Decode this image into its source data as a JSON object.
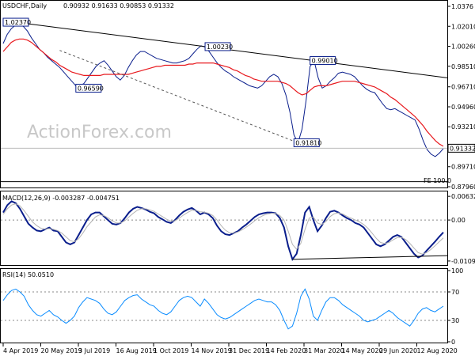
{
  "chart_data": [
    {
      "type": "line",
      "panel": "price",
      "header": "USDCHF,Daily",
      "header_values": "0.90932 0.91633 0.90853 0.91332",
      "watermark": "ActionForex.com",
      "fe_label": "FE 100.0",
      "last_price": "0.91332",
      "ylim": [
        0.8796,
        1.0376
      ],
      "y_ticks": [
        1.0376,
        1.0201,
        1.0026,
        0.9851,
        0.9671,
        0.9496,
        0.9321,
        0.9146,
        0.8971,
        0.8796
      ],
      "y_tick_labels": [
        "1.0376",
        "1.02010",
        "1.00260",
        "0.98510",
        "0.96710",
        "0.94960",
        "0.93210",
        "0.91460",
        "0.89710",
        "0.87960"
      ],
      "x_labels": [
        "4 Apr 2019",
        "20 May 2019",
        "3 Jul 2019",
        "16 Aug 2019",
        "1 Oct 2019",
        "14 Nov 2019",
        "31 Dec 2019",
        "14 Feb 2020",
        "31 Mar 2020",
        "14 May 2020",
        "29 Jun 2020",
        "12 Aug 2020"
      ],
      "series": [
        {
          "name": "price",
          "color": "#0a1e8c",
          "values": [
            1.005,
            1.013,
            1.018,
            1.021,
            1.022,
            1.02,
            1.016,
            1.01,
            1.005,
            1.0,
            0.997,
            0.993,
            0.99,
            0.987,
            0.984,
            0.98,
            0.976,
            0.972,
            0.968,
            0.968,
            0.97,
            0.975,
            0.98,
            0.985,
            0.988,
            0.99,
            0.986,
            0.981,
            0.976,
            0.973,
            0.977,
            0.984,
            0.99,
            0.995,
            0.998,
            0.998,
            0.996,
            0.994,
            0.992,
            0.991,
            0.99,
            0.989,
            0.988,
            0.988,
            0.989,
            0.99,
            0.992,
            0.996,
            1.0,
            1.003,
            1.002,
            0.998,
            0.993,
            0.988,
            0.984,
            0.981,
            0.979,
            0.976,
            0.974,
            0.972,
            0.97,
            0.968,
            0.967,
            0.966,
            0.968,
            0.972,
            0.976,
            0.978,
            0.976,
            0.97,
            0.96,
            0.945,
            0.925,
            0.918,
            0.93,
            0.955,
            0.985,
            0.99,
            0.975,
            0.966,
            0.968,
            0.972,
            0.975,
            0.979,
            0.98,
            0.979,
            0.978,
            0.976,
            0.972,
            0.968,
            0.965,
            0.963,
            0.962,
            0.957,
            0.952,
            0.948,
            0.947,
            0.948,
            0.946,
            0.944,
            0.942,
            0.94,
            0.938,
            0.93,
            0.92,
            0.912,
            0.908,
            0.906,
            0.909,
            0.913
          ]
        },
        {
          "name": "MA",
          "color": "#e8191e",
          "values": [
            0.998,
            1.002,
            1.006,
            1.008,
            1.009,
            1.009,
            1.008,
            1.006,
            1.003,
            1.0,
            0.997,
            0.994,
            0.991,
            0.989,
            0.986,
            0.984,
            0.982,
            0.98,
            0.979,
            0.978,
            0.977,
            0.977,
            0.977,
            0.977,
            0.977,
            0.978,
            0.978,
            0.978,
            0.978,
            0.978,
            0.978,
            0.978,
            0.979,
            0.98,
            0.981,
            0.982,
            0.983,
            0.984,
            0.985,
            0.985,
            0.986,
            0.986,
            0.986,
            0.986,
            0.986,
            0.986,
            0.987,
            0.987,
            0.988,
            0.988,
            0.988,
            0.988,
            0.988,
            0.987,
            0.986,
            0.985,
            0.984,
            0.982,
            0.981,
            0.979,
            0.977,
            0.976,
            0.974,
            0.973,
            0.972,
            0.972,
            0.972,
            0.972,
            0.972,
            0.971,
            0.97,
            0.968,
            0.965,
            0.962,
            0.96,
            0.961,
            0.964,
            0.967,
            0.968,
            0.968,
            0.968,
            0.969,
            0.97,
            0.971,
            0.972,
            0.972,
            0.972,
            0.972,
            0.971,
            0.97,
            0.969,
            0.968,
            0.967,
            0.965,
            0.963,
            0.961,
            0.958,
            0.956,
            0.953,
            0.95,
            0.947,
            0.944,
            0.941,
            0.937,
            0.933,
            0.928,
            0.924,
            0.92,
            0.917,
            0.915
          ]
        }
      ],
      "labels": [
        {
          "text": "1.02370",
          "x": 0,
          "y": 1.0237
        },
        {
          "text": "0.96590",
          "x": 18,
          "y": 0.9659
        },
        {
          "text": "1.00230",
          "x": 50,
          "y": 1.0023
        },
        {
          "text": "0.99010",
          "x": 76,
          "y": 0.9901
        },
        {
          "text": "0.91810",
          "x": 72,
          "y": 0.9181
        }
      ]
    },
    {
      "type": "line",
      "panel": "macd",
      "header": "MACD(12,26,9) -0.003287 -0.004751",
      "ylim": [
        -0.0118,
        0.0072
      ],
      "y_tick_labels": [
        "0.006321",
        "0.00",
        "-0.010939"
      ],
      "y_ticks": [
        0.006321,
        0.0,
        -0.010939
      ],
      "series": [
        {
          "name": "MACD",
          "color": "#0a1e8c",
          "values": [
            0.002,
            0.004,
            0.005,
            0.0045,
            0.003,
            0.001,
            -0.001,
            -0.002,
            -0.0028,
            -0.003,
            -0.0025,
            -0.002,
            -0.0028,
            -0.003,
            -0.0045,
            -0.006,
            -0.0065,
            -0.006,
            -0.004,
            -0.002,
            0.0,
            0.0015,
            0.002,
            0.002,
            0.001,
            0.0,
            -0.001,
            -0.0012,
            -0.0008,
            0.0005,
            0.002,
            0.003,
            0.0035,
            0.0032,
            0.0028,
            0.0022,
            0.0018,
            0.0008,
            0.0002,
            -0.0005,
            -0.0008,
            0.0,
            0.0012,
            0.0022,
            0.0028,
            0.0032,
            0.0025,
            0.0015,
            0.002,
            0.0015,
            0.0005,
            -0.0015,
            -0.003,
            -0.0038,
            -0.004,
            -0.0035,
            -0.003,
            -0.002,
            -0.0012,
            -0.0002,
            0.0008,
            0.0015,
            0.0018,
            0.002,
            0.002,
            0.0018,
            0.0005,
            -0.002,
            -0.007,
            -0.0105,
            -0.009,
            -0.004,
            0.002,
            0.0035,
            0.0,
            -0.003,
            -0.0015,
            0.0005,
            0.0022,
            0.0025,
            0.002,
            0.0012,
            0.0005,
            0.0,
            -0.0008,
            -0.0012,
            -0.002,
            -0.0035,
            -0.005,
            -0.0065,
            -0.007,
            -0.0065,
            -0.0055,
            -0.0045,
            -0.004,
            -0.0045,
            -0.006,
            -0.0075,
            -0.009,
            -0.01,
            -0.0095,
            -0.0082,
            -0.007,
            -0.0058,
            -0.0045,
            -0.0033
          ]
        },
        {
          "name": "Signal",
          "color": "#b4b4b4",
          "values": [
            0.0015,
            0.003,
            0.004,
            0.0043,
            0.0038,
            0.0025,
            0.001,
            -0.0005,
            -0.0015,
            -0.0022,
            -0.0024,
            -0.0023,
            -0.0025,
            -0.0028,
            -0.0035,
            -0.0045,
            -0.0055,
            -0.0058,
            -0.005,
            -0.0035,
            -0.0018,
            -0.0005,
            0.0008,
            0.0014,
            0.0012,
            0.0006,
            -0.0002,
            -0.0008,
            -0.0008,
            -0.0002,
            0.0008,
            0.0018,
            0.0026,
            0.003,
            0.003,
            0.0027,
            0.0023,
            0.0016,
            0.0009,
            0.0002,
            -0.0003,
            -0.0002,
            0.0005,
            0.0013,
            0.002,
            0.0026,
            0.0026,
            0.0022,
            0.0021,
            0.0018,
            0.0012,
            0.0,
            -0.0015,
            -0.0027,
            -0.0034,
            -0.0035,
            -0.0032,
            -0.0026,
            -0.0019,
            -0.0011,
            -0.0002,
            0.0006,
            0.0012,
            0.0016,
            0.0018,
            0.0018,
            0.0012,
            0.0,
            -0.003,
            -0.0065,
            -0.0078,
            -0.0062,
            -0.0025,
            0.0005,
            0.0008,
            -0.0008,
            -0.0012,
            -0.0004,
            0.0009,
            0.0017,
            0.0019,
            0.0016,
            0.001,
            0.0005,
            0.0,
            -0.0005,
            -0.0012,
            -0.0022,
            -0.0035,
            -0.0049,
            -0.006,
            -0.0063,
            -0.006,
            -0.0053,
            -0.0047,
            -0.0046,
            -0.0052,
            -0.0062,
            -0.0075,
            -0.0087,
            -0.0091,
            -0.0087,
            -0.0079,
            -0.0069,
            -0.0058,
            -0.0048
          ]
        }
      ]
    },
    {
      "type": "line",
      "panel": "rsi",
      "header": "RSI(14) 50.0510",
      "ylim": [
        0,
        100
      ],
      "y_ticks": [
        100,
        70,
        30,
        0
      ],
      "y_tick_labels": [
        "100",
        "70",
        "30",
        "0"
      ],
      "series": [
        {
          "name": "RSI",
          "color": "#0a8cff",
          "values": [
            58,
            66,
            72,
            74,
            70,
            64,
            52,
            44,
            38,
            36,
            40,
            44,
            38,
            35,
            30,
            26,
            30,
            36,
            48,
            56,
            62,
            60,
            58,
            54,
            46,
            40,
            38,
            42,
            50,
            58,
            62,
            65,
            66,
            60,
            56,
            52,
            50,
            44,
            40,
            38,
            42,
            50,
            58,
            62,
            64,
            62,
            56,
            50,
            60,
            54,
            46,
            38,
            34,
            32,
            34,
            38,
            42,
            46,
            50,
            54,
            58,
            60,
            58,
            56,
            56,
            52,
            44,
            30,
            18,
            22,
            40,
            64,
            74,
            60,
            36,
            30,
            44,
            56,
            62,
            62,
            58,
            52,
            48,
            44,
            40,
            36,
            30,
            28,
            30,
            32,
            36,
            40,
            44,
            40,
            34,
            30,
            26,
            22,
            30,
            40,
            46,
            48,
            44,
            42,
            46,
            50
          ]
        }
      ]
    }
  ]
}
